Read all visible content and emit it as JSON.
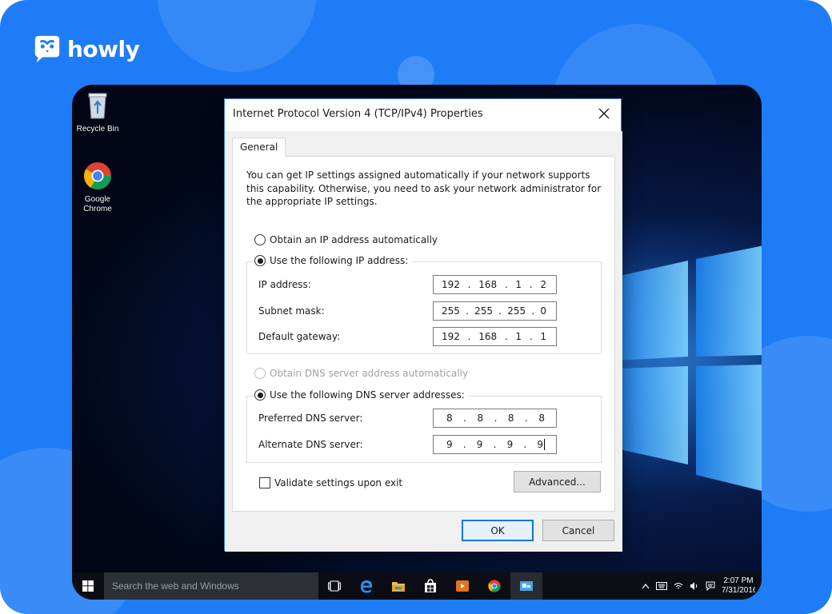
{
  "brand": {
    "name": "howly",
    "logo_icon": "owl-chat-bubble-icon",
    "background_color": "#1e7cf6"
  },
  "desktop": {
    "icons": [
      {
        "label": "Recycle Bin",
        "icon": "recycle-bin-icon"
      },
      {
        "label": "Google Chrome",
        "icon": "chrome-icon"
      }
    ]
  },
  "dialog": {
    "title": "Internet Protocol Version 4 (TCP/IPv4) Properties",
    "close_icon": "close-icon",
    "tab_general": "General",
    "intro_text": "You can get IP settings assigned automatically if your network supports this capability. Otherwise, you need to ask your network administrator for the appropriate IP settings.",
    "ip_auto_label": "Obtain an IP address automatically",
    "ip_manual_label": "Use the following IP address:",
    "ip_mode": "manual",
    "ip_fields": [
      {
        "label": "IP address:",
        "octets": [
          "192",
          "168",
          "1",
          "2"
        ]
      },
      {
        "label": "Subnet mask:",
        "octets": [
          "255",
          "255",
          "255",
          "0"
        ]
      },
      {
        "label": "Default gateway:",
        "octets": [
          "192",
          "168",
          "1",
          "1"
        ]
      }
    ],
    "dns_auto_label": "Obtain DNS server address automatically",
    "dns_manual_label": "Use the following DNS server addresses:",
    "dns_mode": "manual",
    "dns_fields": [
      {
        "label": "Preferred DNS server:",
        "octets": [
          "8",
          "8",
          "8",
          "8"
        ]
      },
      {
        "label": "Alternate DNS server:",
        "octets": [
          "9",
          "9",
          "9",
          "9"
        ]
      }
    ],
    "validate_label": "Validate settings upon exit",
    "validate_checked": false,
    "advanced_button": "Advanced...",
    "ok_button": "OK",
    "cancel_button": "Cancel",
    "accent_color": "#0078d7"
  },
  "taskbar": {
    "search_placeholder": "Search the web and Windows",
    "apps": [
      "task-view-icon",
      "edge-icon",
      "file-explorer-icon",
      "store-icon",
      "media-player-icon",
      "chrome-icon",
      "network-settings-icon"
    ],
    "tray_icons": [
      "chevron-up-icon",
      "keyboard-icon",
      "wifi-icon",
      "volume-icon",
      "action-center-icon"
    ],
    "time": "2:07 PM",
    "date": "7/31/2016"
  }
}
